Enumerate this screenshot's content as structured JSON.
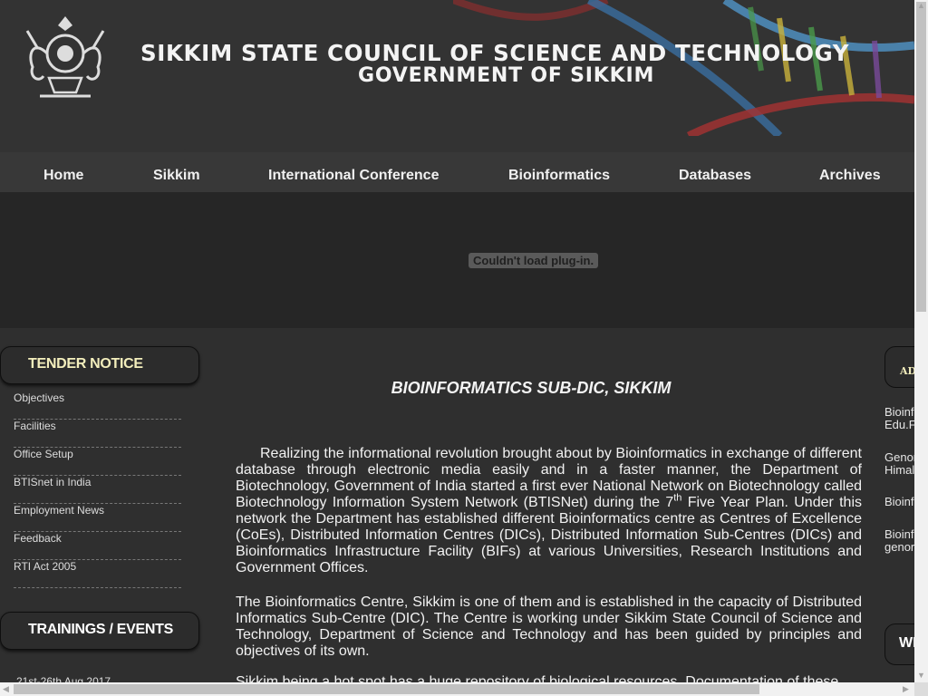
{
  "header": {
    "title_line1": "SIKKIM STATE COUNCIL OF SCIENCE AND TECHNOLOGY",
    "title_line2": "GOVERNMENT OF SIKKIM"
  },
  "nav": {
    "items": [
      "Home",
      "Sikkim",
      "International Conference",
      "Bioinformatics",
      "Databases",
      "Archives"
    ]
  },
  "plugin": {
    "message": "Couldn't load plug-in."
  },
  "left_sidebar": {
    "tender_heading": "TENDER  NOTICE",
    "links": [
      "Objectives",
      "Facilities",
      "Office Setup",
      "BTISnet in India",
      "Employment News",
      "Feedback",
      "RTI Act 2005"
    ],
    "trainings_heading": "TRAININGS / EVENTS",
    "event_date": "21st-26th Aug 2017"
  },
  "main": {
    "title": "BIOINFORMATICS SUB-DIC, SIKKIM",
    "para1_a": "Realizing the informational revolution brought about by Bioinformatics in exchange of different database through electronic media easily and in a faster manner, the Department of Biotechnology, Government of India started a first ever National Network on Biotechnology called Biotechnology Information System Network (BTISNet) during the 7",
    "para1_sup": "th",
    "para1_b": " Five Year Plan. Under this network the Department has established different Bioinformatics centre as Centres of Excellence (CoEs), Distributed Information Centres (DICs), Distributed Information Sub-Centres (DICs) and Bioinformatics Infrastructure Facility (BIFs) at various Universities, Research Institutions and Government Offices.",
    "para2": "The Bioinformatics Centre, Sikkim is one of them and is established in the capacity of Distributed Informatics Sub-Centre (DIC). The Centre is working under Sikkim State Council of Science and Technology, Department of Science and Technology and has been guided by principles and objectives of its own.",
    "para3": "Sikkim being a hot spot has a huge repository of biological resources. Documentation of these"
  },
  "right_sidebar": {
    "heading1": "AD",
    "link1_line1": "Bioinf",
    "link1_line2": "Edu.F",
    "link2_line1": "Genor",
    "link2_line2": "Himal",
    "link3_line1": "Bioinf",
    "link4_line1": "Bioinf",
    "link4_line2": "genor",
    "heading2": "WI"
  },
  "colors": {
    "background": "#2f2f2f",
    "header_bg": "#333333",
    "plugin_bg": "#262626",
    "tender_heading": "#f3eebc"
  }
}
